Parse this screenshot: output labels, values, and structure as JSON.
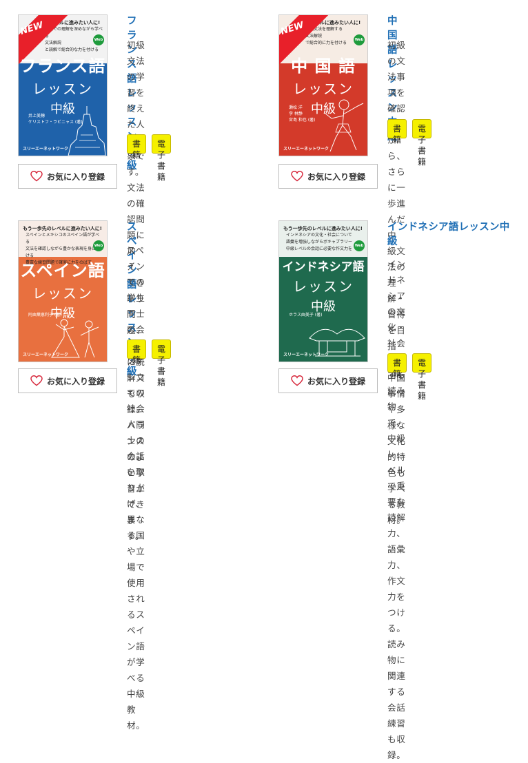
{
  "products": [
    {
      "title": "フランス語レッスン中級",
      "description": [
        "初級文法の学習を終えた人",
        "が対象です。文法の確認問",
        "題に加え、聞き取り問題、",
        "さらに読解文も収録。バラ",
        "ンスのよい学習ができま",
        "す。"
      ],
      "buttons": {
        "print": "書籍",
        "ebook": "電子書籍"
      },
      "favorite": "お気に入り登録",
      "cover": {
        "color": "#1f62aa",
        "new_badge": "NEW",
        "lead": "のレベルに進みたい人に!",
        "bullets": [
          "初級での理解を深めながら学べる",
          "文法解説",
          "と読解で総合的な力を付ける"
        ],
        "title_line1": "フランス語",
        "title_line2": "レッスン",
        "title_line3": "中級",
        "authors": [
          "井上美穂",
          "ケリストフ・ラビニャス (著)"
        ],
        "publisher": "スリーエーネットワーク",
        "web_badge": "Web"
      }
    },
    {
      "title": "中国語レッスン中級",
      "description": [
        "初級の文法事項を確認しな",
        "がら、さらに一歩進んだ中",
        "級文法の理解・習得を目指",
        "し、中国事情や多様な文化",
        "的特色も学べる教材。"
      ],
      "buttons": {
        "print": "書籍",
        "ebook": "電子書籍"
      },
      "favorite": "お気に入り登録",
      "cover": {
        "color": "#d33a2a",
        "new_badge": "NEW",
        "lead": "のレベルに進みたい人に!",
        "bullets": [
          "中級文法を理解する",
          "文法解説",
          "で総合的に力を付ける"
        ],
        "title_line1": "中 国 語",
        "title_line2": "レッスン",
        "title_line3": "中級",
        "authors": [
          "瀬松 洋",
          "李 林静",
          "宮島 和也 (著)"
        ],
        "publisher": "スリーエーネットワーク",
        "web_badge": "Web"
      }
    },
    {
      "title": "スペイン語レッスン中級",
      "description": [
        "スペインでの学生同士の会",
        "話、メキシコでの社会人同",
        "士の会話を取り上げ、異な",
        "る国や立場で使用されるス",
        "ペイン語が学べる中級教",
        "材。"
      ],
      "buttons": {
        "print": "書籍",
        "ebook": "電子書籍"
      },
      "favorite": "お気に入り登録",
      "cover": {
        "color": "#e8703f",
        "lead": "もう一歩先のレベルに進みたい人に!",
        "bullets": [
          "スペインとメキシコのスペイン語が学べる",
          "文法を確認しながら豊かな表現を身につける",
          "豊富な練習問題で確実に力をのばす"
        ],
        "title_line1": "スペイン語",
        "title_line2": "レッスン",
        "title_line3": "中級",
        "authors": [
          "阿由葉恵利子 (著)"
        ],
        "publisher": "スリーエーネットワーク",
        "web_badge": "Web"
      }
    },
    {
      "title": "インドネシア語レッスン中級",
      "description": [
        "インドネシアの文化・社会",
        "に関する読み物で、中級レ",
        "ベルで重要な読解力、語彙",
        "力、作文力をつける。読み",
        "物に関連する会話練習も収",
        "録。"
      ],
      "buttons": {
        "print": "書籍",
        "ebook": "電子書籍"
      },
      "favorite": "お気に入り登録",
      "cover": {
        "color": "#1f6a4e",
        "lead": "もう一歩先のレベルに進みたい人に!",
        "bullets": [
          "インドネシアの文化・社会について文章を読み、理解を深める",
          "語彙を増強しながらボキャブラリービルディング",
          "中級レベルの会話に必要な作文力をつける"
        ],
        "title_line1": "インドネシア語",
        "title_line2": "レッスン",
        "title_line3": "中級",
        "authors": [
          "ホラス由美子 (著)"
        ],
        "publisher": "スリーエーネットワーク",
        "web_badge": "Web"
      }
    }
  ]
}
